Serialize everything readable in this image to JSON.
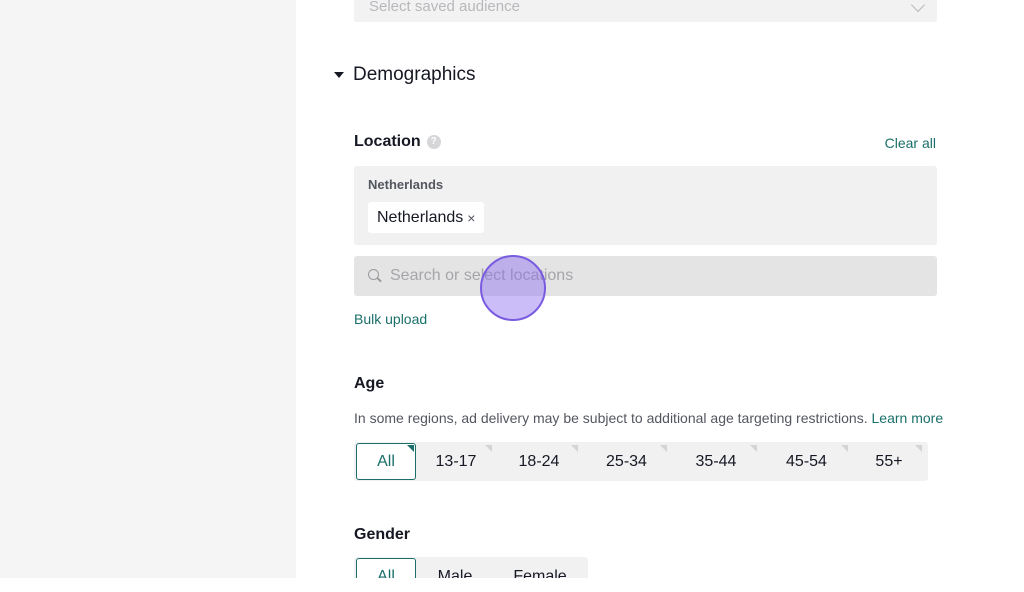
{
  "saved_audience": {
    "placeholder": "Select saved audience"
  },
  "demographics": {
    "title": "Demographics"
  },
  "location": {
    "label": "Location",
    "clear_all": "Clear all",
    "group": "Netherlands",
    "tags": [
      "Netherlands"
    ],
    "tag_remove": "×",
    "search_placeholder": "Search or select locations",
    "bulk_upload": "Bulk upload"
  },
  "age": {
    "label": "Age",
    "note": "In some regions, ad delivery may be subject to additional age targeting restrictions.",
    "learn_more": "Learn more",
    "options": [
      "All",
      "13-17",
      "18-24",
      "25-34",
      "35-44",
      "45-54",
      "55+"
    ],
    "selected": "All"
  },
  "gender": {
    "label": "Gender",
    "options": [
      "All",
      "Male",
      "Female"
    ],
    "selected": "All"
  },
  "colors": {
    "accent": "#1a6f6a",
    "cursor": "#7a5ce0"
  }
}
